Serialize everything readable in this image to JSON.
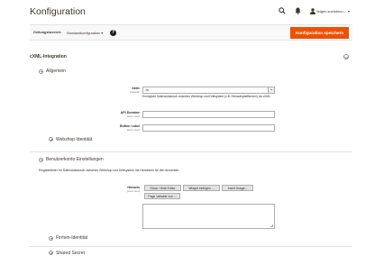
{
  "header": {
    "title": "Konfiguration",
    "user_name": "felgen suchdecu...",
    "search_icon": "search-icon",
    "bell_icon": "bell-icon",
    "user_icon": "user-icon"
  },
  "scope": {
    "label": "Geltungsbereich:",
    "value": "Standardkonfiguration",
    "help": "?",
    "save_label": "Konfiguration speichern"
  },
  "section": {
    "title": "cXML-Integration"
  },
  "allgemein": {
    "title": "Allgemein",
    "aktiv_label": "Aktiv",
    "aktiv_scope": "[website]",
    "aktiv_value": "Ja",
    "aktiv_note": "Ermöglicht Datenaustausch zwischen Webshop und Drittsystem (z.B. Einkaufsplattformen) via cXML.",
    "api_label": "API-Domäne",
    "api_scope": "[store view]",
    "button_label": "Button Label",
    "button_scope": "[store view]"
  },
  "webshop_identitaet": {
    "title": "Webshop Identität"
  },
  "benutzerkonto": {
    "title": "Benutzerkonto Einstellungen",
    "description": "Eingabefelder für Datenaustausch zwischen Webshop und Drittsystem mit Hinweisen für den Anwender.",
    "hinweis_label": "Hinweis",
    "hinweis_scope": "[store view]",
    "btn_show_hide": "Show / Hide Editor",
    "btn_widget": "Widget einfügen ...",
    "btn_image": "Insert Image...",
    "btn_variable": "Page Variable von ..."
  },
  "firmen_identitaet": {
    "title": "Firmen-Identität"
  },
  "shared_secret": {
    "title": "Shared Secret"
  }
}
